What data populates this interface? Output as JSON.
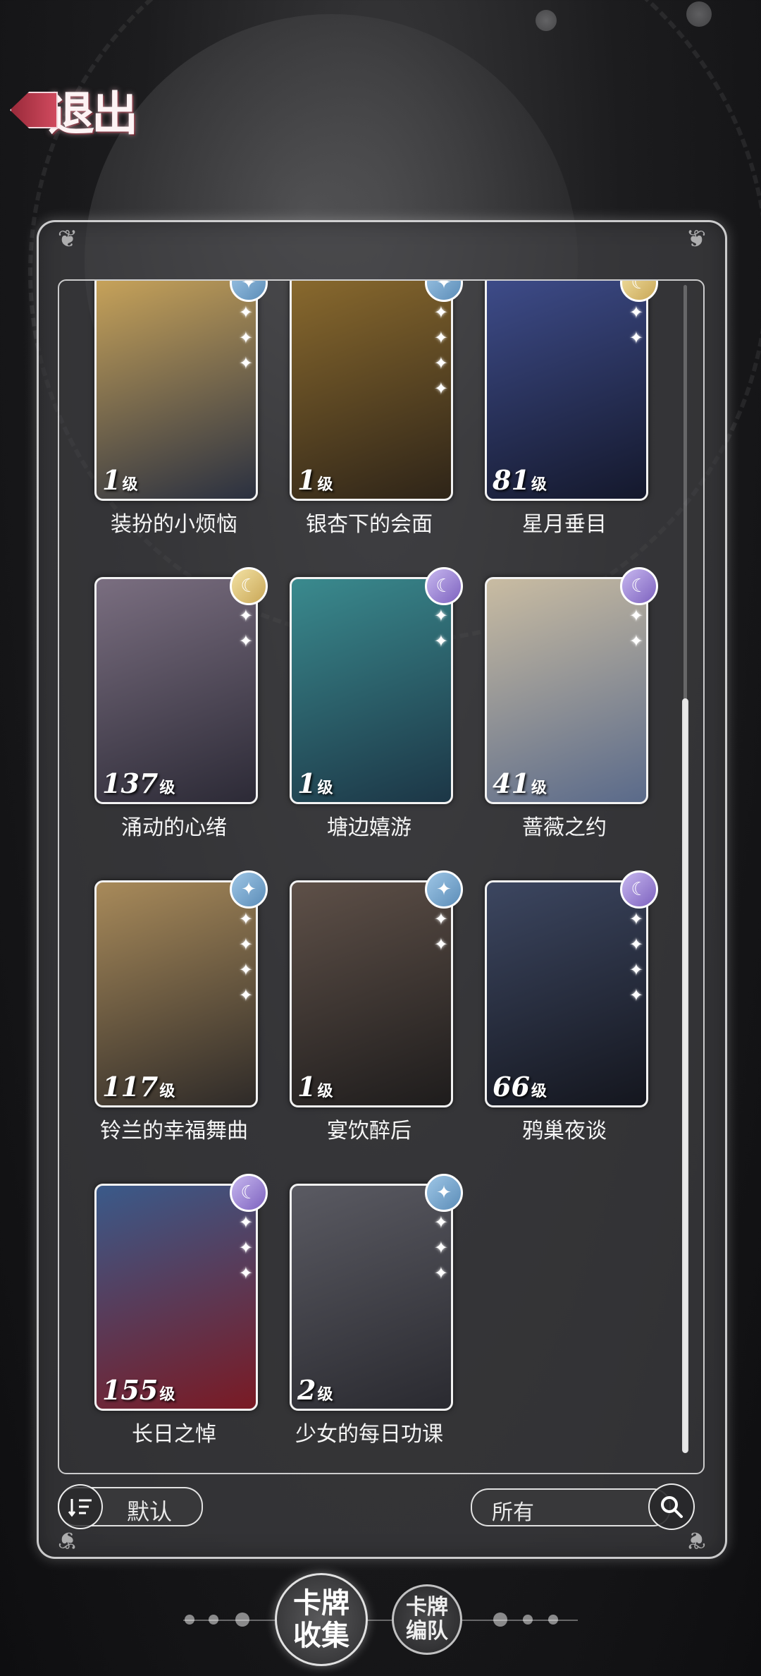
{
  "header": {
    "back_label": "退出"
  },
  "cards": [
    {
      "title": "装扮的小烦恼",
      "level": "1",
      "level_unit": "级",
      "rarity": "blue",
      "stars": 3,
      "colors": [
        "#c9a45a",
        "#2a3040"
      ]
    },
    {
      "title": "银杏下的会面",
      "level": "1",
      "level_unit": "级",
      "rarity": "blue",
      "stars": 4,
      "colors": [
        "#8a6a2e",
        "#2e2418"
      ]
    },
    {
      "title": "星月垂目",
      "level": "81",
      "level_unit": "级",
      "rarity": "gold",
      "stars": 2,
      "colors": [
        "#3e4c8a",
        "#14182c"
      ]
    },
    {
      "title": "涌动的心绪",
      "level": "137",
      "level_unit": "级",
      "rarity": "gold",
      "stars": 2,
      "colors": [
        "#7a6e80",
        "#2c2a36"
      ]
    },
    {
      "title": "塘边嬉游",
      "level": "1",
      "level_unit": "级",
      "rarity": "purple",
      "stars": 2,
      "colors": [
        "#3a8a8e",
        "#1c3646"
      ]
    },
    {
      "title": "蔷薇之约",
      "level": "41",
      "level_unit": "级",
      "rarity": "purple",
      "stars": 2,
      "colors": [
        "#c9bca2",
        "#5a6a8a"
      ]
    },
    {
      "title": "铃兰的幸福舞曲",
      "level": "117",
      "level_unit": "级",
      "rarity": "blue",
      "stars": 4,
      "colors": [
        "#a88a5a",
        "#2e2a28"
      ]
    },
    {
      "title": "宴饮醉后",
      "level": "1",
      "level_unit": "级",
      "rarity": "blue",
      "stars": 2,
      "colors": [
        "#5e5048",
        "#1e1c1c"
      ]
    },
    {
      "title": "鸦巢夜谈",
      "level": "66",
      "level_unit": "级",
      "rarity": "purple",
      "stars": 4,
      "colors": [
        "#3c4660",
        "#14161e"
      ]
    },
    {
      "title": "长日之悼",
      "level": "155",
      "level_unit": "级",
      "rarity": "purple",
      "stars": 3,
      "colors": [
        "#3a5a8a",
        "#7a1a24"
      ]
    },
    {
      "title": "少女的每日功课",
      "level": "2",
      "level_unit": "级",
      "rarity": "blue",
      "stars": 3,
      "colors": [
        "#5a5a62",
        "#2a2a30"
      ]
    }
  ],
  "controls": {
    "sort_label": "默认",
    "filter_label": "所有"
  },
  "tabs": [
    {
      "label_line1": "卡牌",
      "label_line2": "收集"
    },
    {
      "label_line1": "卡牌",
      "label_line2": "编队"
    }
  ],
  "scroll_position": 0.35
}
